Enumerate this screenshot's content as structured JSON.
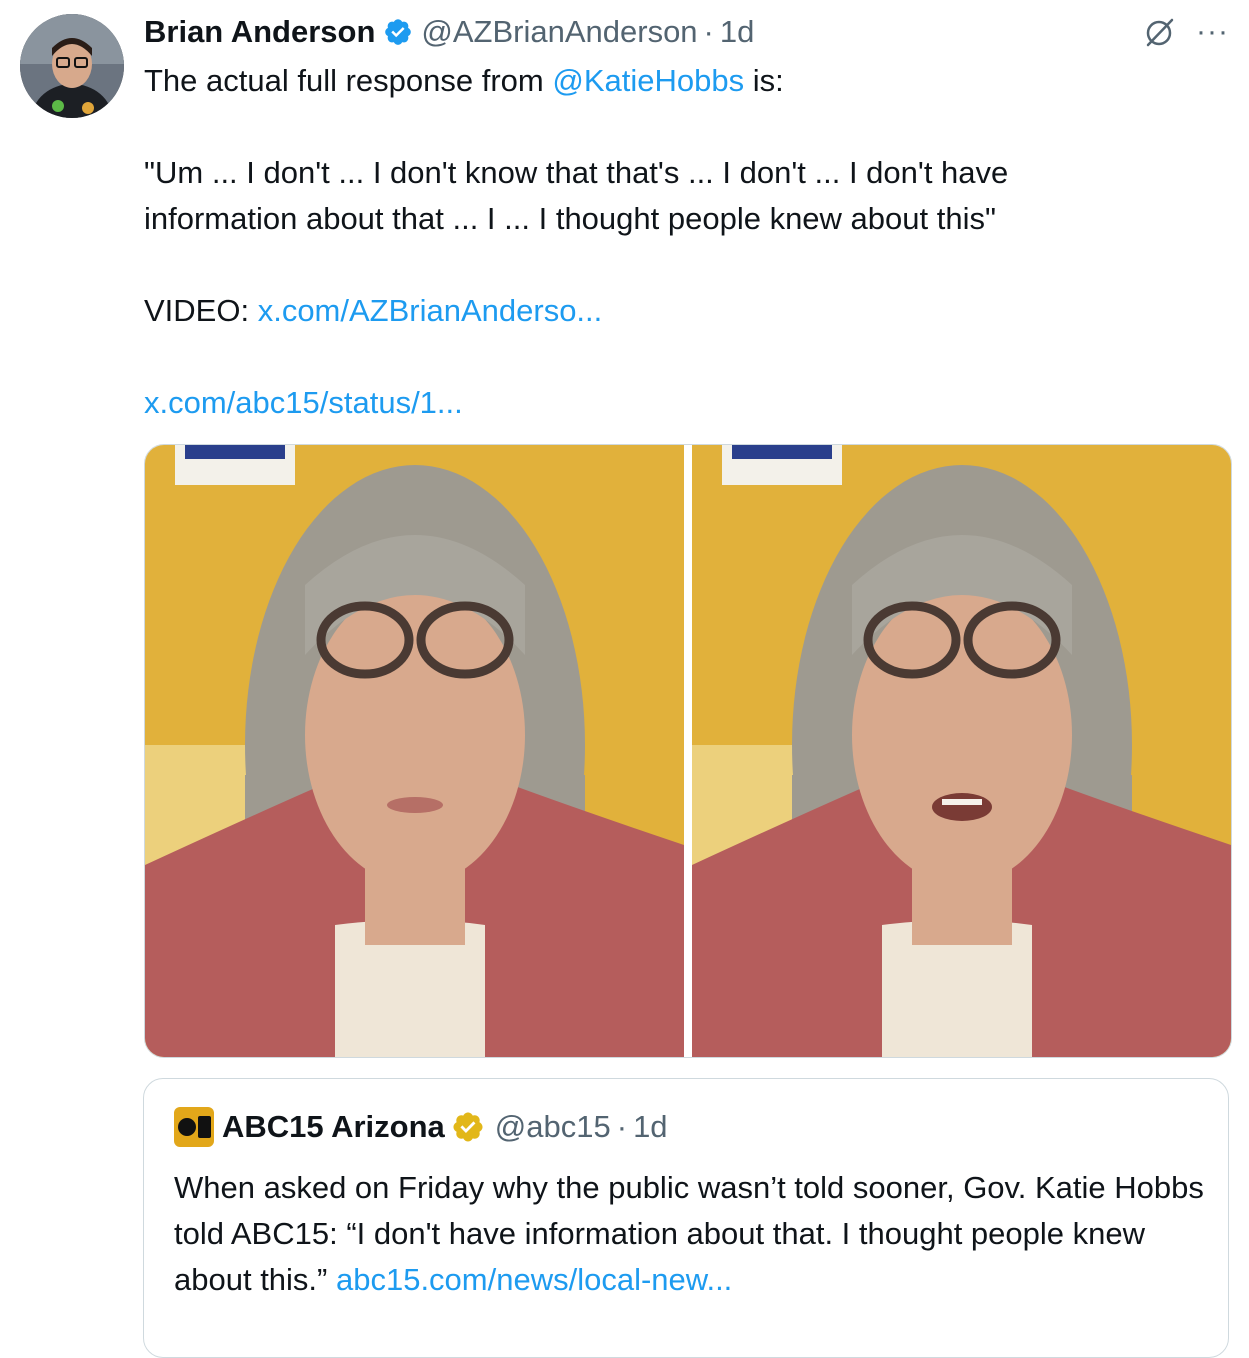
{
  "author": {
    "name": "Brian Anderson",
    "handle": "@AZBrianAnderson",
    "time": "1d",
    "separator": "·",
    "avatar_icon": "avatar-photo",
    "verified_icon": "verified-badge-icon",
    "more_label": "···"
  },
  "tweet": {
    "line1_prefix": "The actual full response from ",
    "mention": "@KatieHobbs",
    "line1_suffix": " is:",
    "quote": "\"Um ... I don't ... I don't know that that's ... I don't ... I don't have\ninformation about that ... I ... I thought people knew about this\"",
    "video_label": "VIDEO: ",
    "video_link": "x.com/AZBrianAnderso...",
    "status_link": "x.com/abc15/status/1..."
  },
  "quoted": {
    "name": "ABC15 Arizona",
    "handle": "@abc15",
    "separator": "·",
    "time": "1d",
    "text": "When asked on Friday why the public wasn’t told sooner, Gov. Katie Hobbs told ABC15: “I don't have information about that. I thought people knew about this.” ",
    "link": "abc15.com/news/local-new..."
  },
  "colors": {
    "link": "#1d9bf0",
    "verified_blue": "#1d9bf0",
    "verified_gold": "#e2b719",
    "muted": "#536471",
    "border": "#cfd9de"
  }
}
